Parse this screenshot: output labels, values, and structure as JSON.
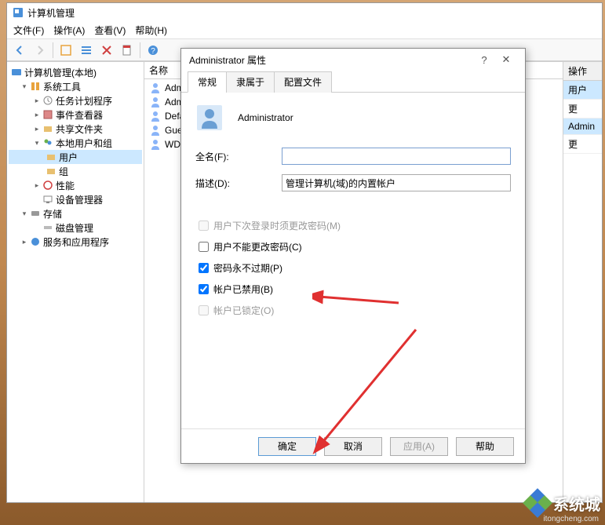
{
  "window": {
    "title": "计算机管理"
  },
  "menu": {
    "file": "文件(F)",
    "action": "操作(A)",
    "view": "查看(V)",
    "help": "帮助(H)"
  },
  "tree": {
    "root": "计算机管理(本地)",
    "system_tools": "系统工具",
    "task_scheduler": "任务计划程序",
    "event_viewer": "事件查看器",
    "shared_folders": "共享文件夹",
    "local_users": "本地用户和组",
    "users": "用户",
    "groups": "组",
    "performance": "性能",
    "device_manager": "设备管理器",
    "storage": "存储",
    "disk_mgmt": "磁盘管理",
    "services_apps": "服务和应用程序"
  },
  "list": {
    "header": "名称",
    "items": [
      "Admini",
      "Admini",
      "Defa",
      "Gues",
      "WDA"
    ]
  },
  "actions": {
    "header": "操作",
    "user": "用户",
    "more1": "更",
    "admin": "Admin",
    "more2": "更"
  },
  "dialog": {
    "title": "Administrator 属性",
    "help_btn": "?",
    "close_btn": "✕",
    "tabs": {
      "general": "常规",
      "member": "隶属于",
      "profile": "配置文件"
    },
    "username": "Administrator",
    "fullname_label": "全名(F):",
    "fullname_value": "",
    "desc_label": "描述(D):",
    "desc_value": "管理计算机(域)的内置帐户",
    "chk_must_change": "用户下次登录时须更改密码(M)",
    "chk_cannot_change": "用户不能更改密码(C)",
    "chk_never_expire": "密码永不过期(P)",
    "chk_disabled": "帐户已禁用(B)",
    "chk_locked": "帐户已锁定(O)",
    "btn_ok": "确定",
    "btn_cancel": "取消",
    "btn_apply": "应用(A)",
    "btn_help": "帮助"
  },
  "watermark": {
    "text": "系统城",
    "url": "itongcheng.com"
  }
}
